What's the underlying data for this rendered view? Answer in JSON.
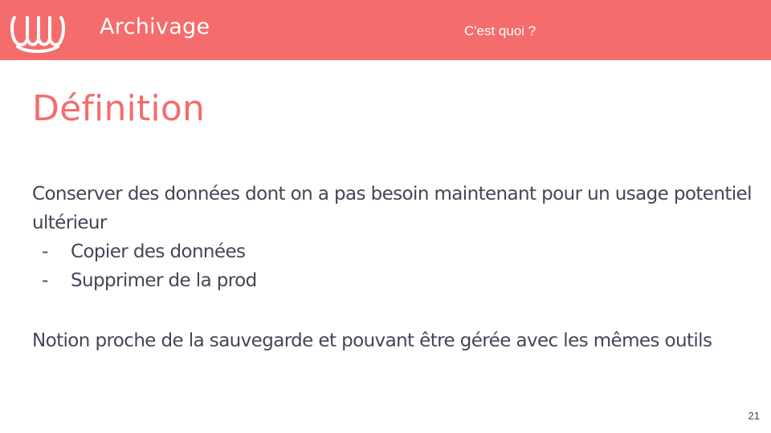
{
  "header": {
    "title": "Archivage",
    "subtitle": "C'est quoi ?",
    "logo_icon": "wave-logo-icon",
    "background_color": "#f56c6c"
  },
  "slide": {
    "title": "Définition",
    "title_color": "#f56c6c",
    "text_color": "#434656",
    "paragraph1": "Conserver des données dont on a pas besoin maintenant pour un usage potentiel ultérieur",
    "bullets": [
      {
        "marker": "-",
        "text": "Copier des données"
      },
      {
        "marker": "-",
        "text": "Supprimer de la prod"
      }
    ],
    "paragraph2": "Notion proche de la sauvegarde et pouvant être gérée avec les mêmes outils"
  },
  "footer": {
    "page_number": "21"
  }
}
